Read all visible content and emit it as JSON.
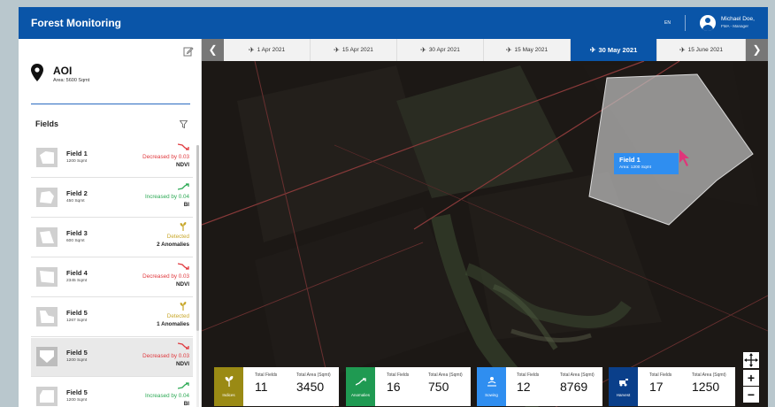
{
  "header": {
    "title": "Forest Monitoring",
    "language": "EN",
    "user_name": "Michael Doe,",
    "user_role": "FMA - Manager",
    "bar_color": "#0a55a8"
  },
  "aoi": {
    "title": "AOI",
    "area": "Area: 5600 Sqmt"
  },
  "fields_panel": {
    "title": "Fields",
    "items": [
      {
        "name": "Field 1",
        "area": "1200 Sqmt",
        "indicator": "Decreased by 0.03",
        "metric": "NDVI",
        "trend": "down"
      },
      {
        "name": "Field 2",
        "area": "450 Sqmt",
        "indicator": "Increased by 0.04",
        "metric": "BI",
        "trend": "up"
      },
      {
        "name": "Field 3",
        "area": "600 Sqmt",
        "indicator": "Detected",
        "metric": "2 Anomalies",
        "trend": "anomaly"
      },
      {
        "name": "Field 4",
        "area": "2345 Sqmt",
        "indicator": "Decreased by 0.03",
        "metric": "NDVI",
        "trend": "down"
      },
      {
        "name": "Field 5",
        "area": "1267 Sqmt",
        "indicator": "Detected",
        "metric": "1 Anomalies",
        "trend": "anomaly"
      },
      {
        "name": "Field 5",
        "area": "1200 Sqmt",
        "indicator": "Decreased by 0.03",
        "metric": "NDVI",
        "trend": "down"
      },
      {
        "name": "Field 5",
        "area": "1200 Sqmt",
        "indicator": "Increased by 0.04",
        "metric": "BI",
        "trend": "up"
      }
    ]
  },
  "timeline": {
    "dates": [
      "1 Apr 2021",
      "15 Apr 2021",
      "30 Apr 2021",
      "15 May 2021",
      "30 May 2021",
      "15 June 2021"
    ],
    "selected": "30 May 2021"
  },
  "map_tooltip": {
    "title": "Field 1",
    "area": "Area: 1200 Sqmt"
  },
  "summary_cards": [
    {
      "label": "Indices",
      "color": "#9a8a14",
      "fields_label": "Total Fields",
      "fields_value": "11",
      "area_label": "Total Area (Sqmt)",
      "area_value": "3450"
    },
    {
      "label": "Anomalies",
      "color": "#1f9a52",
      "fields_label": "Total Fields",
      "fields_value": "16",
      "area_label": "Total Area (Sqmt)",
      "area_value": "750"
    },
    {
      "label": "Sowing",
      "color": "#2f8ef0",
      "fields_label": "Total Fields",
      "fields_value": "12",
      "area_label": "Total Area (Sqmt)",
      "area_value": "8769"
    },
    {
      "label": "Harvest",
      "color": "#0a3f8a",
      "fields_label": "Total Fields",
      "fields_value": "17",
      "area_label": "Total Area (Sqmt)",
      "area_value": "1250"
    }
  ],
  "zoom": {
    "in_label": "+",
    "out_label": "−"
  },
  "icons": {
    "edit": "edit-icon",
    "location": "location-pin-icon",
    "filter": "filter-icon",
    "move": "move-icon",
    "prev": "chevron-left-icon",
    "next": "chevron-right-icon",
    "satellite": "satellite-icon"
  }
}
